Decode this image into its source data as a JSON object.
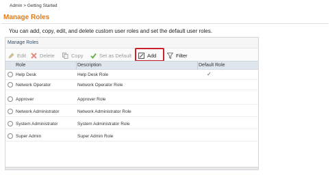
{
  "breadcrumb": "Admin > Getting Started",
  "page_title": "Manage Roles",
  "intro": "You can add, copy, edit, and delete custom user roles and set the default user roles.",
  "panel": {
    "title": "Manage Roles"
  },
  "toolbar": {
    "edit": "Edit",
    "delete": "Delete",
    "copy": "Copy",
    "set_default": "Set as Default",
    "add": "Add",
    "filter": "Filter"
  },
  "grid": {
    "columns": [
      "Role",
      "Description",
      "Default Role"
    ],
    "rows": [
      {
        "role": "Help Desk",
        "description": "Help Desk Role",
        "default": "✓"
      },
      {
        "role": "Network Operator",
        "description": "Network Operator Role",
        "default": ""
      },
      {
        "role": "Approver",
        "description": "Approver Role",
        "default": ""
      },
      {
        "role": "Network Administrator",
        "description": "Network Administrator Role",
        "default": ""
      },
      {
        "role": "System Administrator",
        "description": "System Administrator Role",
        "default": ""
      },
      {
        "role": "Super Admin",
        "description": "Super Admin Role",
        "default": ""
      }
    ]
  },
  "colors": {
    "title": "#e07b1a",
    "highlight": "#c9222b",
    "header_bg": "#dfe6ee"
  }
}
